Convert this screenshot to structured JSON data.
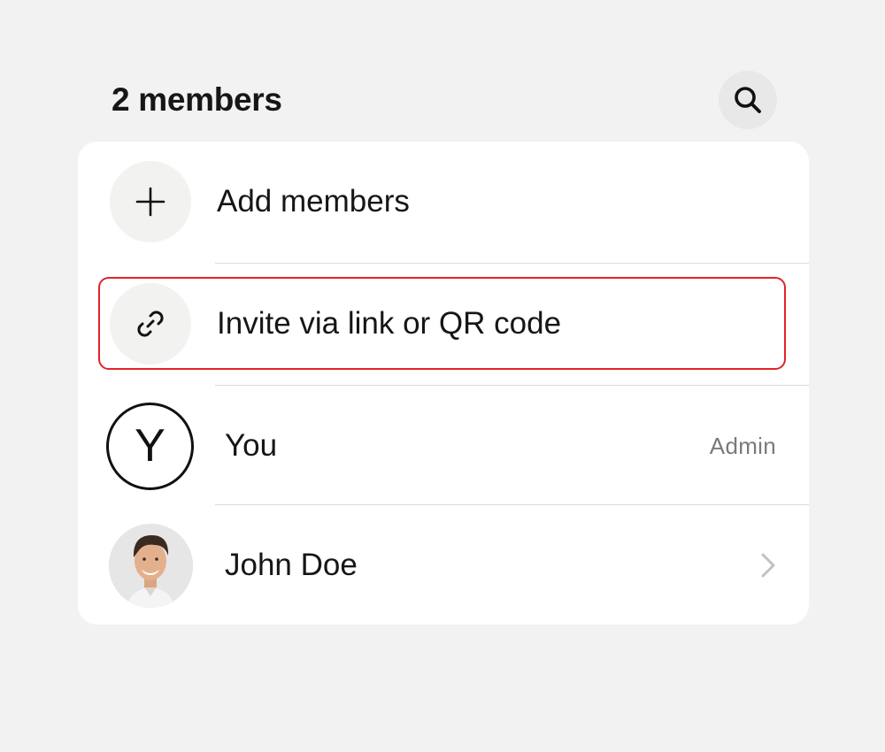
{
  "header": {
    "title": "2 members",
    "search_icon": "search-icon"
  },
  "actions": {
    "add_members": {
      "label": "Add members",
      "icon": "plus-icon"
    },
    "invite": {
      "label": "Invite via link or QR code",
      "icon": "link-icon"
    }
  },
  "members": [
    {
      "name": "You",
      "avatar_letter": "Y",
      "role": "Admin"
    },
    {
      "name": "John Doe",
      "avatar": "photo",
      "icon": "chevron-right-icon"
    }
  ],
  "colors": {
    "background": "#f2f2f2",
    "card": "#ffffff",
    "highlight": "#e0242a",
    "muted_text": "#7a7a7a"
  }
}
